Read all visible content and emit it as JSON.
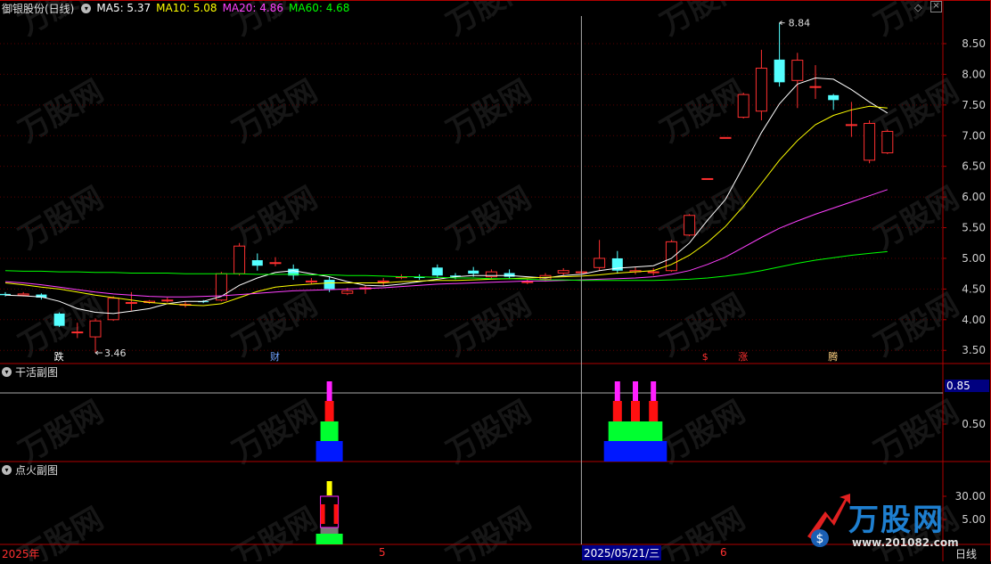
{
  "header": {
    "title": "御银股份(日线)",
    "ma5": "MA5: 5.37",
    "ma10": "MA10: 5.08",
    "ma20": "MA20: 4.86",
    "ma60": "MA60: 4.68",
    "colors": {
      "title": "#e0e0e0",
      "ma5": "#ffffff",
      "ma10": "#ffff00",
      "ma20": "#ff40ff",
      "ma60": "#00ff00"
    }
  },
  "main_axis": [
    "8.50",
    "8.00",
    "7.50",
    "7.00",
    "6.50",
    "6.00",
    "5.50",
    "5.00",
    "4.50",
    "4.00",
    "3.50"
  ],
  "annotations": {
    "high": "8.84",
    "low": "3.46"
  },
  "event_markers": [
    {
      "text": "跌",
      "color": "#ffffff"
    },
    {
      "text": "财",
      "color": "#6fa0ff"
    },
    {
      "text": "$",
      "color": "#ff3030"
    },
    {
      "text": "涨",
      "color": "#ff3030"
    },
    {
      "text": "腾",
      "color": "#ffd080"
    }
  ],
  "sub1": {
    "title": "干活副图",
    "axis": [
      "0.50"
    ],
    "current": "0.85"
  },
  "sub2": {
    "title": "点火副图",
    "axis": [
      "30.00",
      "5.00"
    ]
  },
  "bottom_axis": {
    "start": "2025年",
    "m5": "5",
    "cursor_date": "2025/05/21/三",
    "m6": "6",
    "period": "日线"
  },
  "watermark": {
    "brand": "万股网",
    "url": "www.201082.com"
  },
  "chart_data": {
    "type": "candlestick",
    "ylim": [
      3.3,
      8.95
    ],
    "candles": [
      [
        4.42,
        4.4,
        4.45,
        4.38
      ],
      [
        4.4,
        4.42,
        4.45,
        4.38
      ],
      [
        4.41,
        4.36,
        4.43,
        4.33
      ],
      [
        4.1,
        3.9,
        4.12,
        3.88
      ],
      [
        3.8,
        3.8,
        3.95,
        3.7
      ],
      [
        3.72,
        3.98,
        4.02,
        3.46
      ],
      [
        4.0,
        4.35,
        4.38,
        3.98
      ],
      [
        4.28,
        4.28,
        4.45,
        4.15
      ],
      [
        4.28,
        4.3,
        4.32,
        4.26
      ],
      [
        4.32,
        4.32,
        4.36,
        4.28
      ],
      [
        4.24,
        4.25,
        4.3,
        4.2
      ],
      [
        4.3,
        4.29,
        4.32,
        4.27
      ],
      [
        4.32,
        4.75,
        4.78,
        4.3
      ],
      [
        4.75,
        5.2,
        5.25,
        4.72
      ],
      [
        4.97,
        4.88,
        5.08,
        4.8
      ],
      [
        4.92,
        4.93,
        5.02,
        4.87
      ],
      [
        4.83,
        4.72,
        4.9,
        4.65
      ],
      [
        4.62,
        4.63,
        4.68,
        4.58
      ],
      [
        4.65,
        4.5,
        4.7,
        4.45
      ],
      [
        4.43,
        4.47,
        4.52,
        4.4
      ],
      [
        4.5,
        4.52,
        4.56,
        4.42
      ],
      [
        4.62,
        4.63,
        4.68,
        4.55
      ],
      [
        4.7,
        4.7,
        4.74,
        4.66
      ],
      [
        4.7,
        4.68,
        4.74,
        4.65
      ],
      [
        4.85,
        4.72,
        4.9,
        4.68
      ],
      [
        4.72,
        4.7,
        4.76,
        4.66
      ],
      [
        4.8,
        4.75,
        4.86,
        4.7
      ],
      [
        4.7,
        4.78,
        4.82,
        4.66
      ],
      [
        4.76,
        4.7,
        4.82,
        4.66
      ],
      [
        4.61,
        4.62,
        4.66,
        4.58
      ],
      [
        4.66,
        4.72,
        4.76,
        4.62
      ],
      [
        4.76,
        4.8,
        4.84,
        4.72
      ],
      [
        4.78,
        4.78,
        4.82,
        4.76
      ],
      [
        4.85,
        5.0,
        5.3,
        4.8
      ],
      [
        5.0,
        4.8,
        5.12,
        4.75
      ],
      [
        4.78,
        4.8,
        4.86,
        4.74
      ],
      [
        4.78,
        4.78,
        4.84,
        4.72
      ],
      [
        4.8,
        5.27,
        5.3,
        4.78
      ],
      [
        5.38,
        5.7,
        5.72,
        5.36
      ],
      [
        6.3,
        6.3,
        6.3,
        6.3
      ],
      [
        6.97,
        6.97,
        6.97,
        6.97
      ],
      [
        7.3,
        7.67,
        7.7,
        7.28
      ],
      [
        7.4,
        8.1,
        8.4,
        7.25
      ],
      [
        8.24,
        7.87,
        8.84,
        7.8
      ],
      [
        7.9,
        8.23,
        8.35,
        7.45
      ],
      [
        7.8,
        7.8,
        8.15,
        7.6
      ],
      [
        7.66,
        7.58,
        7.68,
        7.42
      ],
      [
        7.18,
        7.18,
        7.55,
        6.98
      ],
      [
        6.6,
        7.2,
        7.25,
        6.55
      ],
      [
        6.72,
        7.07,
        7.1,
        6.7
      ]
    ],
    "ma": [
      {
        "name": "MA5",
        "color": "#ffffff",
        "values": [
          4.4,
          4.39,
          4.37,
          4.3,
          4.18,
          4.12,
          4.1,
          4.14,
          4.18,
          4.26,
          4.3,
          4.3,
          4.38,
          4.56,
          4.68,
          4.77,
          4.8,
          4.75,
          4.7,
          4.62,
          4.56,
          4.55,
          4.58,
          4.62,
          4.66,
          4.7,
          4.72,
          4.72,
          4.72,
          4.7,
          4.68,
          4.72,
          4.74,
          4.8,
          4.84,
          4.86,
          4.88,
          5.0,
          5.25,
          5.62,
          5.96,
          6.5,
          7.05,
          7.52,
          7.84,
          7.94,
          7.92,
          7.75,
          7.55,
          7.37
        ]
      },
      {
        "name": "MA10",
        "color": "#ffff00",
        "values": [
          4.6,
          4.57,
          4.53,
          4.5,
          4.45,
          4.4,
          4.36,
          4.32,
          4.28,
          4.26,
          4.24,
          4.23,
          4.26,
          4.36,
          4.46,
          4.53,
          4.56,
          4.58,
          4.6,
          4.6,
          4.6,
          4.6,
          4.62,
          4.63,
          4.64,
          4.64,
          4.65,
          4.66,
          4.67,
          4.68,
          4.69,
          4.7,
          4.71,
          4.73,
          4.76,
          4.78,
          4.8,
          4.9,
          5.05,
          5.26,
          5.52,
          5.85,
          6.22,
          6.6,
          6.92,
          7.18,
          7.33,
          7.42,
          7.48,
          7.45
        ]
      },
      {
        "name": "MA20",
        "color": "#ff40ff",
        "values": [
          4.62,
          4.6,
          4.57,
          4.53,
          4.49,
          4.45,
          4.42,
          4.4,
          4.38,
          4.37,
          4.37,
          4.38,
          4.39,
          4.41,
          4.43,
          4.45,
          4.47,
          4.48,
          4.49,
          4.5,
          4.51,
          4.52,
          4.54,
          4.56,
          4.58,
          4.59,
          4.6,
          4.61,
          4.62,
          4.63,
          4.63,
          4.64,
          4.65,
          4.66,
          4.67,
          4.68,
          4.7,
          4.74,
          4.8,
          4.9,
          5.02,
          5.18,
          5.34,
          5.49,
          5.61,
          5.72,
          5.82,
          5.92,
          6.02,
          6.12
        ]
      },
      {
        "name": "MA60",
        "color": "#00ff00",
        "values": [
          4.8,
          4.79,
          4.79,
          4.78,
          4.78,
          4.77,
          4.77,
          4.76,
          4.76,
          4.76,
          4.75,
          4.75,
          4.75,
          4.75,
          4.74,
          4.74,
          4.74,
          4.73,
          4.73,
          4.72,
          4.72,
          4.71,
          4.7,
          4.7,
          4.69,
          4.68,
          4.68,
          4.67,
          4.67,
          4.66,
          4.65,
          4.65,
          4.64,
          4.64,
          4.64,
          4.64,
          4.64,
          4.65,
          4.66,
          4.68,
          4.71,
          4.75,
          4.8,
          4.86,
          4.92,
          4.97,
          5.01,
          5.05,
          5.08,
          5.11
        ]
      }
    ],
    "signal_bars_sub1": [
      {
        "index": 18,
        "layers": [
          "blue",
          "green",
          "red",
          "magenta"
        ]
      },
      {
        "index": 34,
        "layers": [
          "blue",
          "green",
          "red",
          "magenta"
        ]
      },
      {
        "index": 35,
        "layers": [
          "blue",
          "green",
          "red",
          "magenta"
        ]
      },
      {
        "index": 36,
        "layers": [
          "blue",
          "green",
          "red",
          "magenta"
        ]
      }
    ],
    "signal_bars_sub2": [
      {
        "index": 18,
        "layers": [
          "green",
          "gray",
          "red",
          "yellow"
        ]
      }
    ]
  }
}
